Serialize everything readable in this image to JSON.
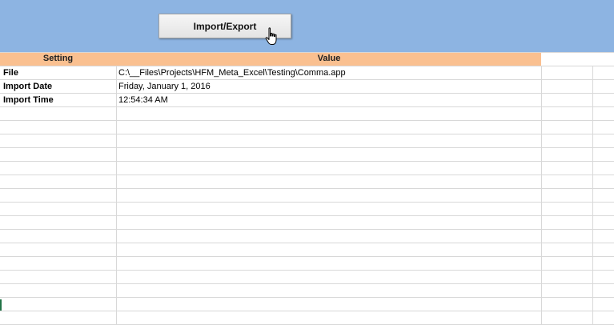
{
  "toolbar": {
    "import_export_label": "Import/Export"
  },
  "table": {
    "headers": {
      "setting": "Setting",
      "value": "Value"
    },
    "rows": [
      {
        "setting": "File",
        "value": "C:\\__Files\\Projects\\HFM_Meta_Excel\\Testing\\Comma.app"
      },
      {
        "setting": "Import Date",
        "value": "Friday, January 1, 2016"
      },
      {
        "setting": "Import Time",
        "value": "12:54:34 AM"
      }
    ]
  },
  "colors": {
    "band": "#8db4e2",
    "header": "#fac090"
  }
}
